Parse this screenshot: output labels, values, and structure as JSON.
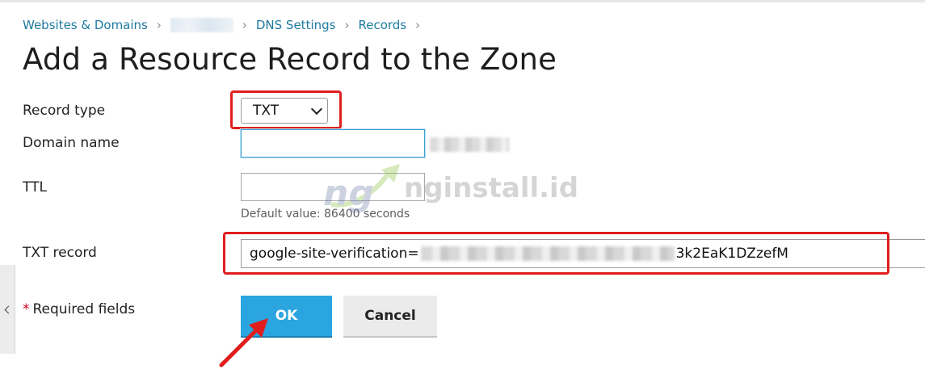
{
  "breadcrumb": {
    "items": [
      "Websites & Domains",
      "DNS Settings",
      "Records"
    ],
    "separator": "›"
  },
  "page": {
    "title": "Add a Resource Record to the Zone"
  },
  "form": {
    "record_type_label": "Record type",
    "record_type_value": "TXT",
    "domain_name_label": "Domain name",
    "domain_name_value": "",
    "ttl_label": "TTL",
    "ttl_value": "",
    "ttl_hint": "Default value: 86400 seconds",
    "txt_record_label": "TXT record",
    "txt_record_prefix": "google-site-verification=",
    "txt_record_suffix": "3k2EaK1DZzefM",
    "required_star": "*",
    "required_label": "Required fields"
  },
  "buttons": {
    "ok_label": "OK",
    "cancel_label": "Cancel"
  },
  "watermark": {
    "logo_text": "nginstall.id"
  },
  "colors": {
    "accent": "#2aa5e0",
    "link": "#1f7aa0",
    "highlight_box": "#e01e1e",
    "required": "#d0021b"
  },
  "icons": {
    "select_caret": "chevron-down-icon",
    "sidebar_toggle": "chevron-left-icon",
    "annotation_arrow": "red-arrow-icon"
  }
}
